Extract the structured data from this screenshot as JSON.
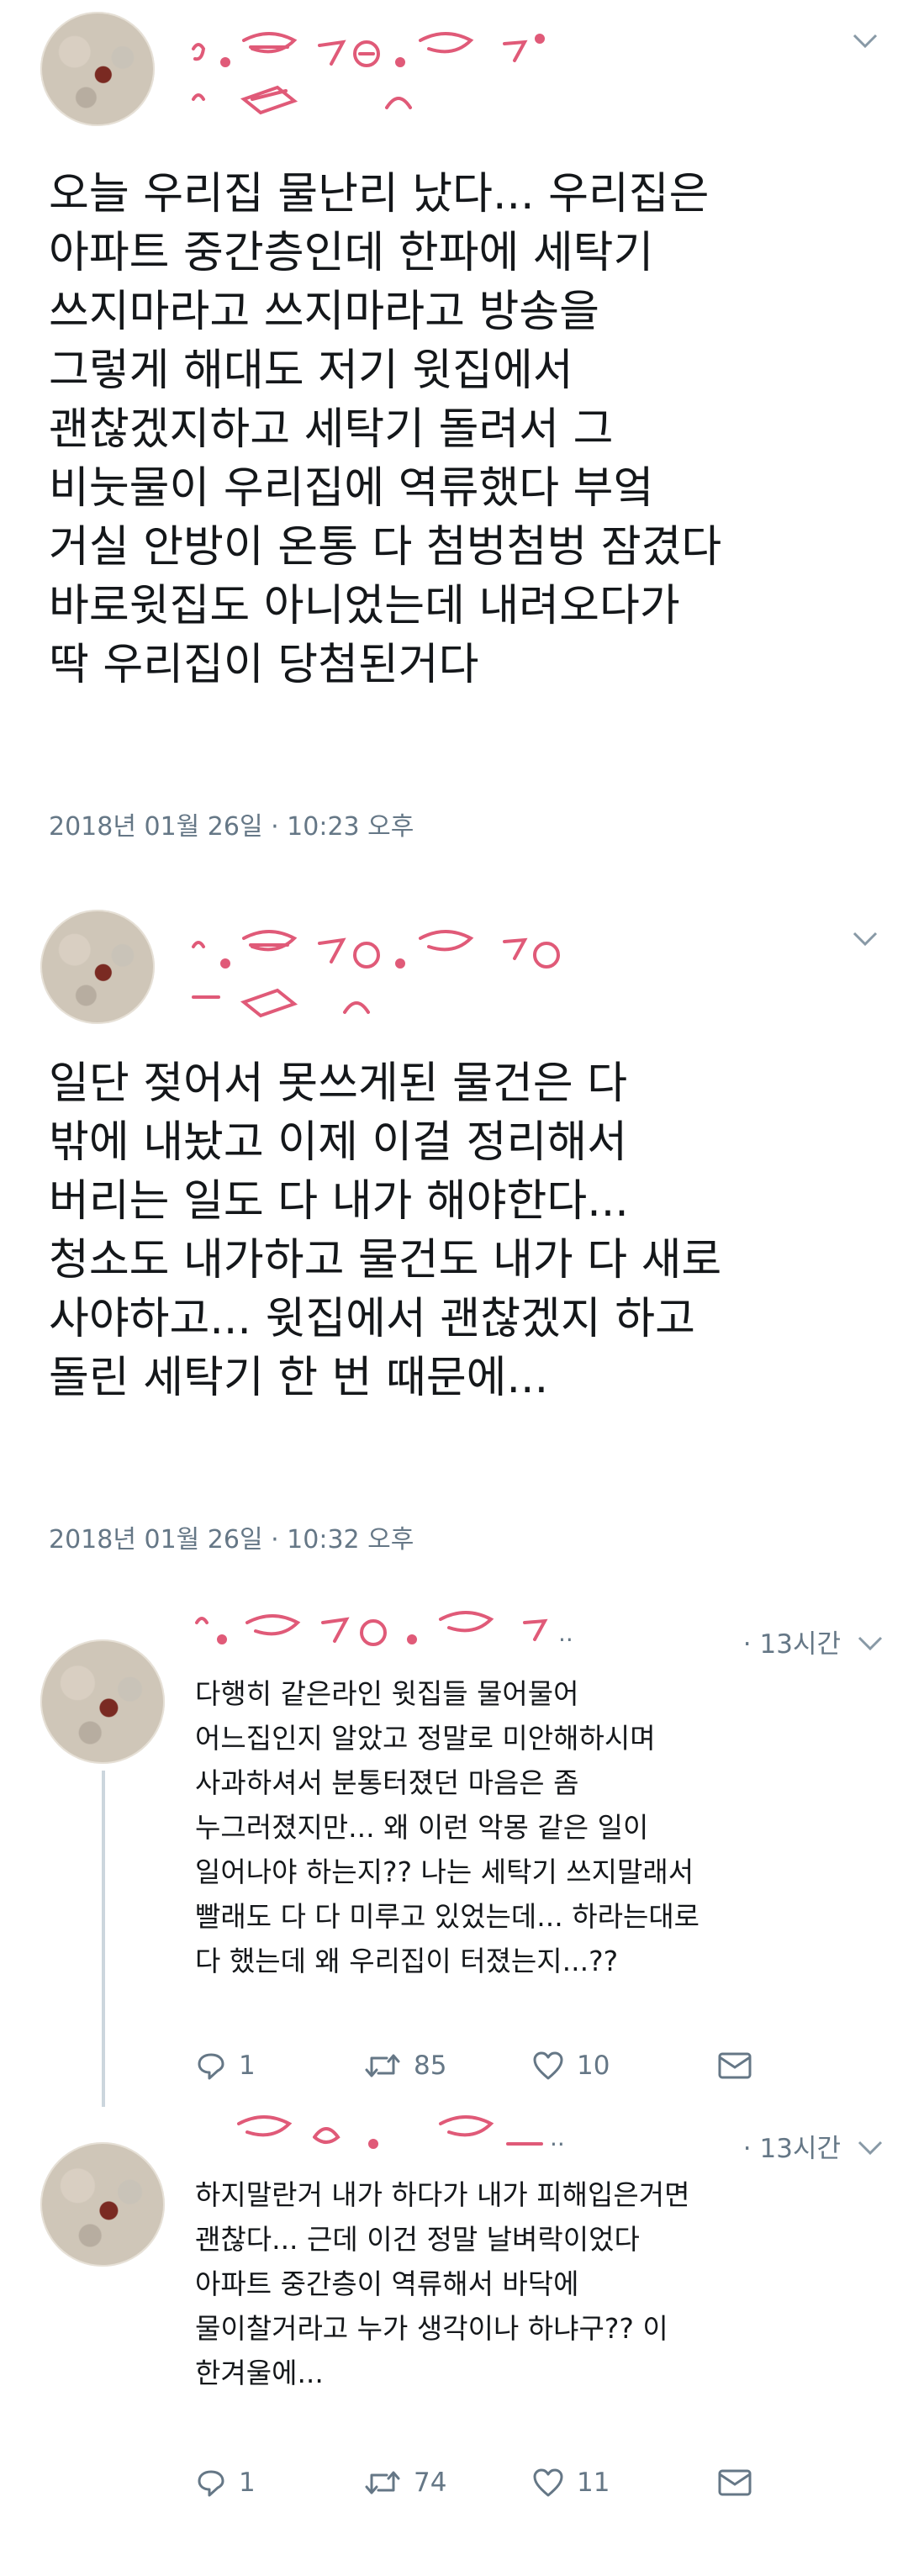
{
  "tweets": [
    {
      "text": "오늘 우리집 물난리 났다... 우리집은\n아파트 중간층인데 한파에 세탁기\n쓰지마라고 쓰지마라고 방송을\n그렇게 해대도 저기 윗집에서\n괜찮겠지하고 세탁기 돌려서 그\n비눗물이 우리집에 역류했다 부엌\n거실 안방이 온통 다 첨벙첨벙 잠겼다\n바로윗집도 아니었는데 내려오다가\n딱 우리집이 당첨된거다",
      "timestamp": "2018년 01월 26일 · 10:23 오후"
    },
    {
      "text": "일단 젖어서 못쓰게된 물건은 다\n밖에 내놨고 이제 이걸 정리해서\n버리는 일도 다 내가 해야한다...\n청소도 내가하고 물건도 내가 다 새로\n사야하고... 윗집에서 괜찮겠지 하고\n돌린 세탁기 한 번 때문에...",
      "timestamp": "2018년 01월 26일 · 10:32 오후"
    }
  ],
  "replies": [
    {
      "time_ago": "· 13시간",
      "text": "다행히 같은라인 윗집들 물어물어\n어느집인지 알았고 정말로 미안해하시며\n사과하셔서 분통터졌던 마음은 좀\n누그러졌지만... 왜 이런 악몽 같은 일이\n일어나야 하는지?? 나는 세탁기 쓰지말래서\n빨래도 다 다 미루고 있었는데... 하라는대로\n다 했는데 왜 우리집이 터졌는지...??",
      "replies_count": "1",
      "retweets": "85",
      "likes": "10"
    },
    {
      "time_ago": "· 13시간",
      "text": "하지말란거 내가 하다가 내가 피해입은거면\n괜찮다... 근데 이건 정말 날벼락이었다\n아파트 중간층이 역류해서 바닥에\n물이찰거라고 누가 생각이나 하냐구?? 이\n한겨울에...",
      "replies_count": "1",
      "retweets": "74",
      "likes": "11"
    }
  ],
  "colors": {
    "text": "#14171a",
    "muted": "#657786",
    "doodle": "#e05a78",
    "thread": "#ccd6dd"
  },
  "icons": [
    "avatar",
    "censor-doodle",
    "chevron-down-icon",
    "reply-icon",
    "retweet-icon",
    "like-icon",
    "dm-icon"
  ]
}
